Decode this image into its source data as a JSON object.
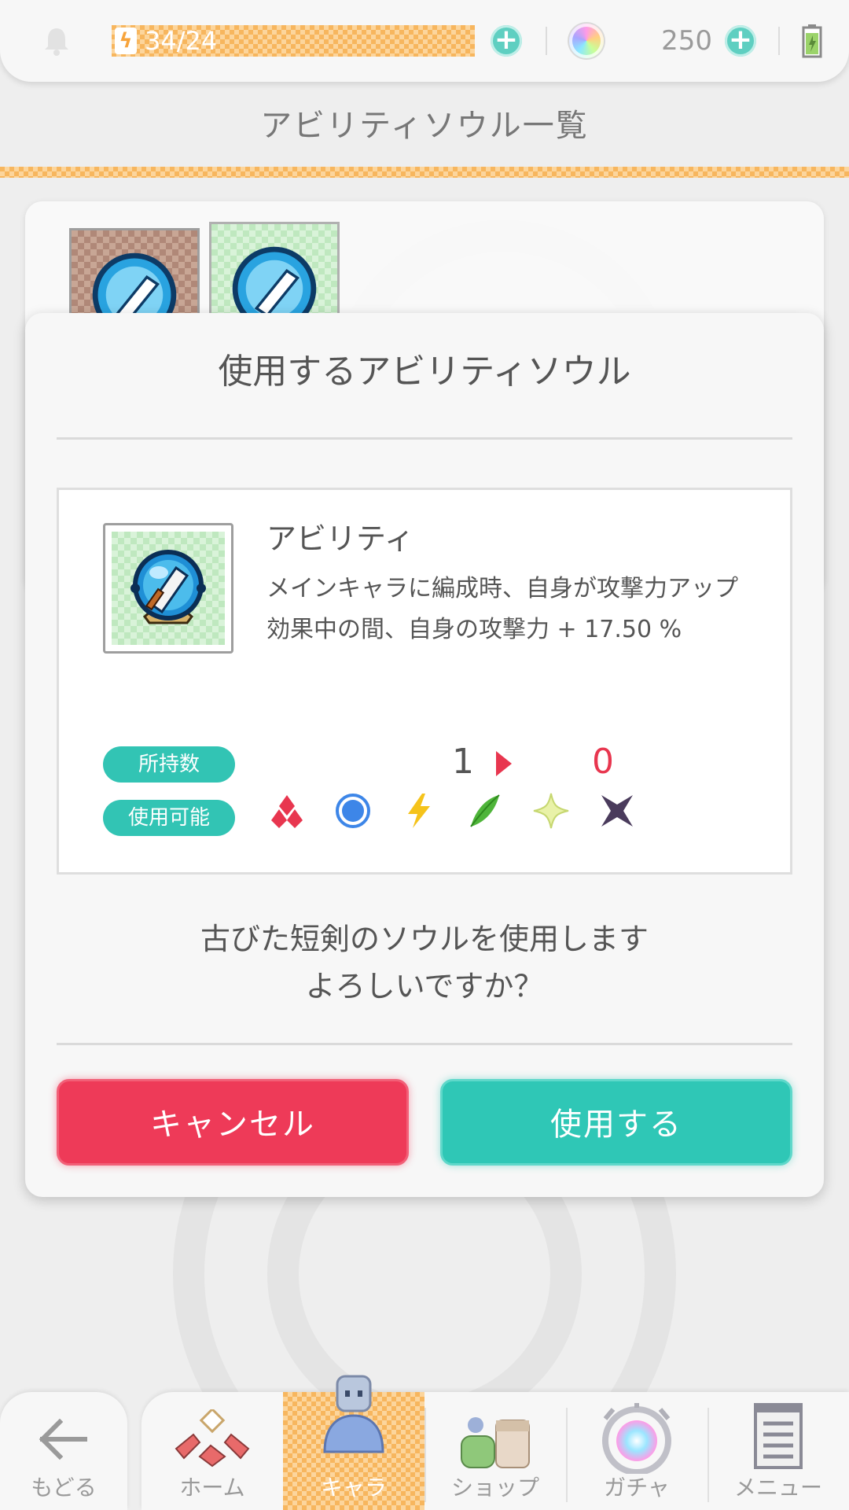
{
  "status_bar": {
    "stamina": "34/24",
    "stamina_fill": 1.0,
    "gems": "250"
  },
  "header": {
    "title": "アビリティソウル一覧"
  },
  "modal": {
    "title": "使用するアビリティソウル",
    "ability_name": "アビリティ",
    "ability_desc": "メインキャラに編成時、自身が攻撃力アップ効果中の間、自身の攻撃力 + 17.50 %",
    "owned_label": "所持数",
    "owned_before": "1",
    "owned_after": "0",
    "usable_label": "使用可能",
    "usable_elements": [
      "fire-element-icon",
      "water-element-icon",
      "thunder-element-icon",
      "wind-element-icon",
      "light-element-icon",
      "dark-element-icon"
    ],
    "confirm_line1": "古びた短剣のソウルを使用します",
    "confirm_line2": "よろしいですか？",
    "cancel_label": "キャンセル",
    "use_label": "使用する"
  },
  "colors": {
    "cancel": "#ee3a58",
    "use": "#2fc7b6",
    "accent_orange": "#f7b65e",
    "teal_pill": "#32c4b4",
    "count_after": "#e8364f"
  },
  "bottom_nav": {
    "back": "もどる",
    "items": [
      {
        "label": "ホーム",
        "icon": "home-icon"
      },
      {
        "label": "キャラ",
        "icon": "chara-icon",
        "active": true
      },
      {
        "label": "ショップ",
        "icon": "shop-icon"
      },
      {
        "label": "ガチャ",
        "icon": "gacha-icon"
      },
      {
        "label": "メニュー",
        "icon": "menu-icon"
      }
    ]
  }
}
